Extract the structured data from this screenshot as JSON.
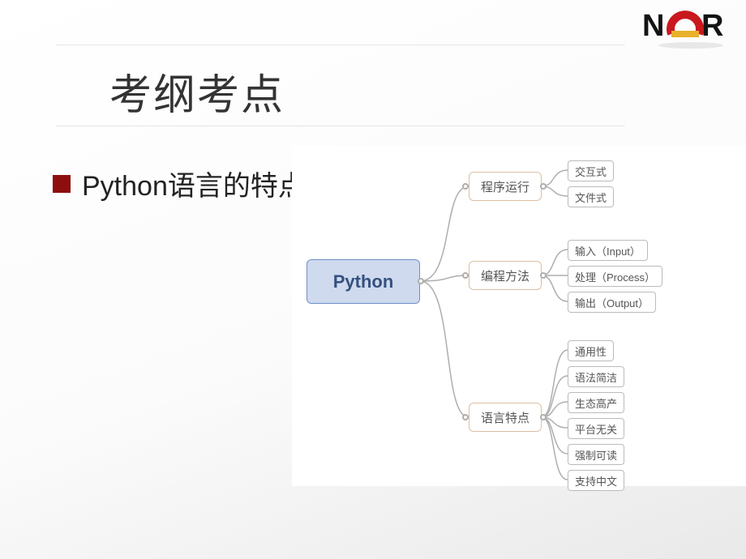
{
  "slide": {
    "title": "考纲考点",
    "bullet": "Python语言的特点"
  },
  "logo": {
    "text": "NCR"
  },
  "mindmap": {
    "root": "Python",
    "branches": [
      {
        "label": "程序运行",
        "leaves": [
          "交互式",
          "文件式"
        ]
      },
      {
        "label": "编程方法",
        "leaves": [
          "输入（Input）",
          "处理（Process）",
          "输出（Output）"
        ]
      },
      {
        "label": "语言特点",
        "leaves": [
          "通用性",
          "语法简洁",
          "生态高产",
          "平台无关",
          "强制可读",
          "支持中文"
        ]
      }
    ]
  }
}
